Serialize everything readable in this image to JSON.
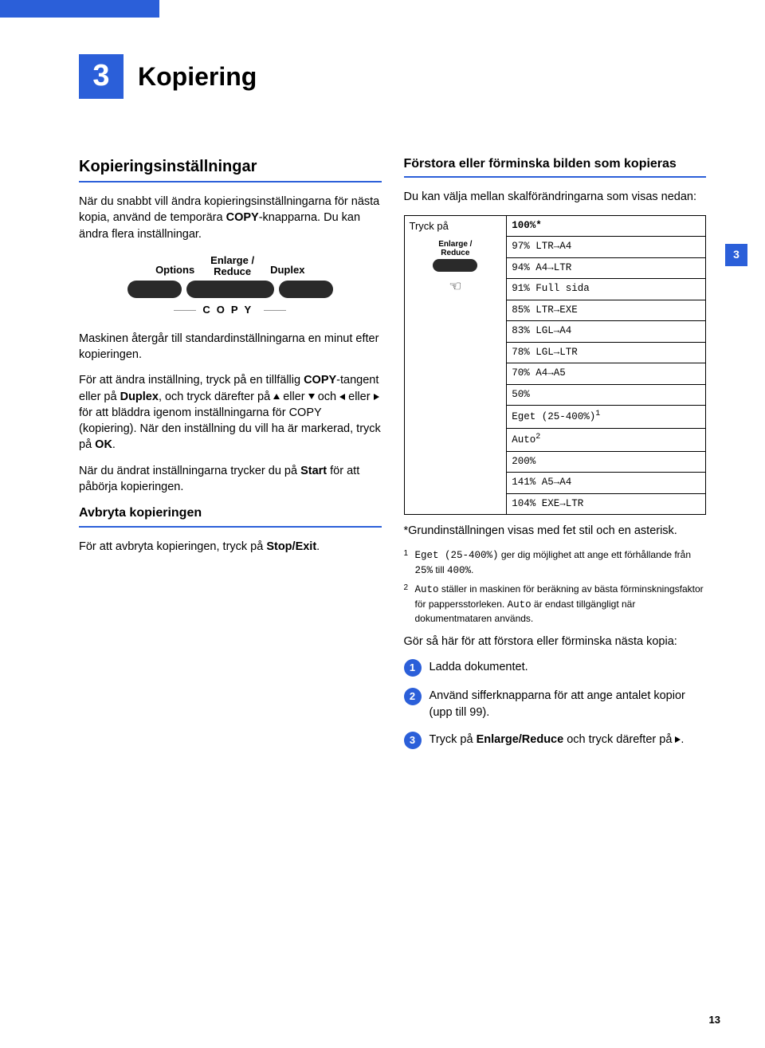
{
  "chapter": {
    "num": "3",
    "title": "Kopiering"
  },
  "sideTab": "3",
  "pageNum": "13",
  "left": {
    "h1": "Kopieringsinställningar",
    "p1a": "När du snabbt vill ändra kopieringsinställningarna för nästa kopia, använd de temporära ",
    "p1b": "COPY",
    "p1c": "-knapparna. Du kan ändra flera inställningar.",
    "kb": {
      "options": "Options",
      "enlarge1": "Enlarge /",
      "enlarge2": "Reduce",
      "duplex": "Duplex",
      "copy": "COPY"
    },
    "p2": "Maskinen återgår till standardinställningarna en minut efter kopieringen.",
    "p3a": "För att ändra inställning, tryck på en tillfällig ",
    "p3b": "COPY",
    "p3c": "-tangent eller på ",
    "p3d": "Duplex",
    "p3e": ", och tryck därefter på ",
    "p3f": " eller ",
    "p3g": " och ",
    "p3h": " eller ",
    "p3i": " för att bläddra igenom inställningarna för COPY (kopiering). När den inställning du vill ha är markerad, tryck på ",
    "p3j": "OK",
    "p3k": ".",
    "p4a": "När du ändrat inställningarna trycker du på ",
    "p4b": "Start",
    "p4c": " för att påbörja kopieringen.",
    "h2": "Avbryta kopieringen",
    "p5a": "För att avbryta kopieringen, tryck på ",
    "p5b": "Stop/Exit",
    "p5c": "."
  },
  "right": {
    "h1": "Förstora eller förminska bilden som kopieras",
    "p1": "Du kan välja mellan skalförändringarna som visas nedan:",
    "tbl": {
      "head": "Tryck på",
      "er1": "Enlarge /",
      "er2": "Reduce",
      "rows": [
        "100%*",
        "97% LTR→A4",
        "94% A4→LTR",
        "91% Full sida",
        "85% LTR→EXE",
        "83% LGL→A4",
        "78% LGL→LTR",
        "70% A4→A5",
        "50%",
        "Eget (25-400%)",
        "Auto",
        "200%",
        "141% A5→A4",
        "104% EXE→LTR"
      ]
    },
    "ast": "*Grundinställningen visas med fet stil och en asterisk.",
    "fn1a": "Eget (25-400%)",
    "fn1b": " ger dig möjlighet att ange ett förhållande från ",
    "fn1c": "25%",
    "fn1d": " till ",
    "fn1e": "400%",
    "fn1f": ".",
    "fn2a": "Auto",
    "fn2b": " ställer in maskinen för beräkning av bästa förminskningsfaktor för pappersstorleken. ",
    "fn2c": "Auto",
    "fn2d": " är endast tillgängligt när dokumentmataren används.",
    "p2": "Gör så här för att förstora eller förminska nästa kopia:",
    "s1": "Ladda dokumentet.",
    "s2": "Använd sifferknapparna för att ange antalet kopior (upp till 99).",
    "s3a": "Tryck på ",
    "s3b": "Enlarge/Reduce",
    "s3c": " och tryck därefter på ",
    "s3d": "."
  }
}
